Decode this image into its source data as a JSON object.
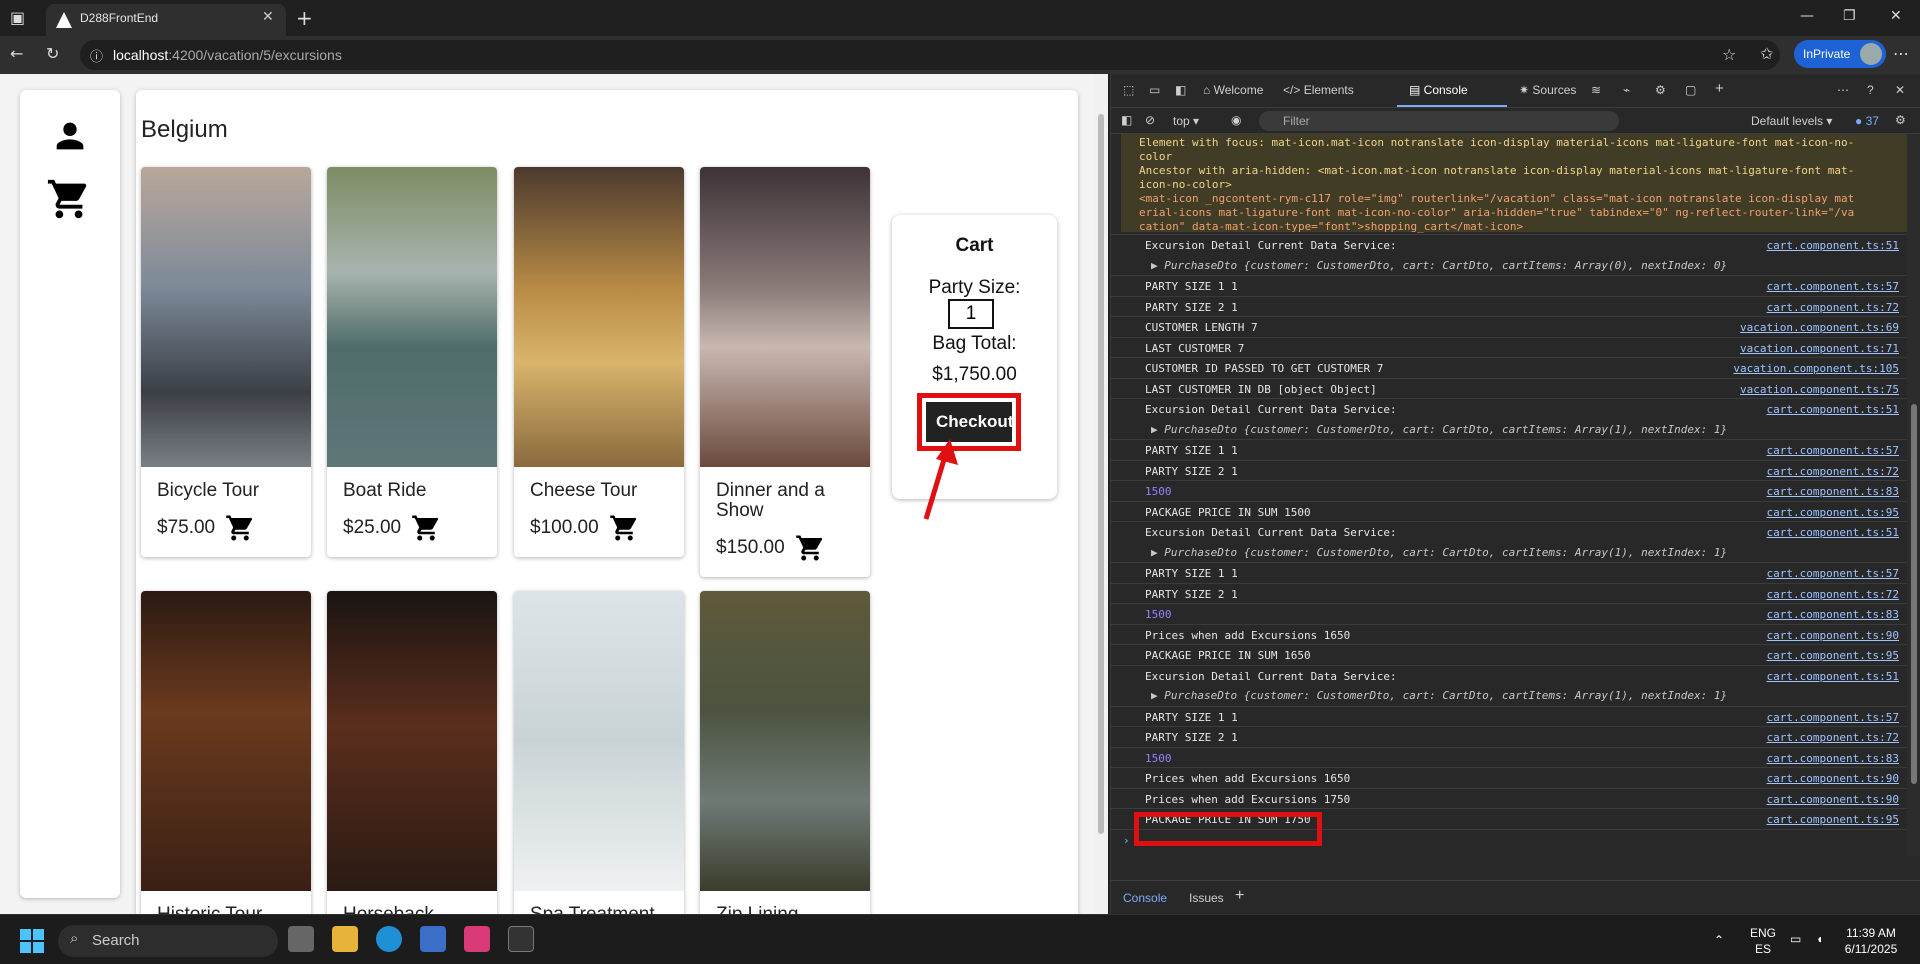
{
  "browser": {
    "tab_title": "D288FrontEnd",
    "url_host": "localhost",
    "url_rest": ":4200/vacation/5/excursions",
    "inprivate_label": "InPrivate"
  },
  "page": {
    "country": "Belgium",
    "excursions": [
      {
        "name": "Bicycle Tour",
        "price": "$75.00"
      },
      {
        "name": "Boat Ride",
        "price": "$25.00"
      },
      {
        "name": "Cheese Tour",
        "price": "$100.00"
      },
      {
        "name": "Dinner and a Show",
        "price": "$150.00"
      },
      {
        "name": "Historic Tour",
        "price": ""
      },
      {
        "name": "Horseback",
        "price": ""
      },
      {
        "name": "Spa Treatment",
        "price": ""
      },
      {
        "name": "Zip Lining",
        "price": ""
      }
    ],
    "cart": {
      "title": "Cart",
      "party_size_label": "Party Size:",
      "party_size_value": "1",
      "bag_total_label": "Bag Total:",
      "bag_total_value": "$1,750.00",
      "checkout_label": "Checkout"
    }
  },
  "devtools": {
    "tabs": [
      "Welcome",
      "Elements",
      "Console",
      "Sources"
    ],
    "context": "top",
    "filter_placeholder": "Filter",
    "levels": "Default levels",
    "issues_count": "37",
    "warning_lines": [
      "Element with focus: mat-icon.mat-icon notranslate icon-display material-icons mat-ligature-font mat-icon-no-",
      "color",
      "Ancestor with aria-hidden: <mat-icon.mat-icon notranslate icon-display material-icons mat-ligature-font mat-",
      "icon-no-color>",
      "  <mat-icon _ngcontent-rym-c117 role=\"img\" routerlink=\"/vacation\" class=\"mat-icon notranslate icon-display mat",
      "  erial-icons mat-ligature-font mat-icon-no-color\" aria-hidden=\"true\" tabindex=\"0\" ng-reflect-router-link=\"/va",
      "  cation\" data-mat-icon-type=\"font\">shopping_cart</mat-icon>"
    ],
    "logs": [
      {
        "msg": "Excursion Detail Current Data Service:",
        "src": "cart.component.ts:51",
        "style": ""
      },
      {
        "msg": "▶ PurchaseDto {customer: CustomerDto, cart: CartDto, cartItems: Array(0), nextIndex: 0}",
        "src": "",
        "style": "ital"
      },
      {
        "msg": "PARTY SIZE 1 1",
        "src": "cart.component.ts:57",
        "style": ""
      },
      {
        "msg": "PARTY SIZE 2 1",
        "src": "cart.component.ts:72",
        "style": ""
      },
      {
        "msg": "CUSTOMER LENGTH 7",
        "src": "vacation.component.ts:69",
        "style": ""
      },
      {
        "msg": "LAST CUSTOMER 7",
        "src": "vacation.component.ts:71",
        "style": ""
      },
      {
        "msg": "CUSTOMER ID PASSED TO GET CUSTOMER 7",
        "src": "vacation.component.ts:105",
        "style": ""
      },
      {
        "msg": "LAST CUSTOMER IN DB [object Object]",
        "src": "vacation.component.ts:75",
        "style": ""
      },
      {
        "msg": "Excursion Detail Current Data Service:",
        "src": "cart.component.ts:51",
        "style": ""
      },
      {
        "msg": "▶ PurchaseDto {customer: CustomerDto, cart: CartDto, cartItems: Array(1), nextIndex: 1}",
        "src": "",
        "style": "ital"
      },
      {
        "msg": "PARTY SIZE 1 1",
        "src": "cart.component.ts:57",
        "style": ""
      },
      {
        "msg": "PARTY SIZE 2 1",
        "src": "cart.component.ts:72",
        "style": ""
      },
      {
        "msg": "1500",
        "src": "cart.component.ts:83",
        "style": "num"
      },
      {
        "msg": "PACKAGE PRICE IN SUM 1500",
        "src": "cart.component.ts:95",
        "style": ""
      },
      {
        "msg": "Excursion Detail Current Data Service:",
        "src": "cart.component.ts:51",
        "style": ""
      },
      {
        "msg": "▶ PurchaseDto {customer: CustomerDto, cart: CartDto, cartItems: Array(1), nextIndex: 1}",
        "src": "",
        "style": "ital"
      },
      {
        "msg": "PARTY SIZE 1 1",
        "src": "cart.component.ts:57",
        "style": ""
      },
      {
        "msg": "PARTY SIZE 2 1",
        "src": "cart.component.ts:72",
        "style": ""
      },
      {
        "msg": "1500",
        "src": "cart.component.ts:83",
        "style": "num"
      },
      {
        "msg": "Prices when add Excursions 1650",
        "src": "cart.component.ts:90",
        "style": ""
      },
      {
        "msg": "PACKAGE PRICE IN SUM 1650",
        "src": "cart.component.ts:95",
        "style": ""
      },
      {
        "msg": "Excursion Detail Current Data Service:",
        "src": "cart.component.ts:51",
        "style": ""
      },
      {
        "msg": "▶ PurchaseDto {customer: CustomerDto, cart: CartDto, cartItems: Array(1), nextIndex: 1}",
        "src": "",
        "style": "ital"
      },
      {
        "msg": "PARTY SIZE 1 1",
        "src": "cart.component.ts:57",
        "style": ""
      },
      {
        "msg": "PARTY SIZE 2 1",
        "src": "cart.component.ts:72",
        "style": ""
      },
      {
        "msg": "1500",
        "src": "cart.component.ts:83",
        "style": "num"
      },
      {
        "msg": "Prices when add Excursions 1650",
        "src": "cart.component.ts:90",
        "style": ""
      },
      {
        "msg": "Prices when add Excursions 1750",
        "src": "cart.component.ts:90",
        "style": ""
      },
      {
        "msg": "PACKAGE PRICE IN SUM 1750",
        "src": "cart.component.ts:95",
        "style": ""
      }
    ],
    "bottom_tabs": [
      "Console",
      "Issues"
    ]
  },
  "taskbar": {
    "search_placeholder": "Search",
    "lang_top": "ENG",
    "lang_bottom": "ES",
    "time": "11:39 AM",
    "date": "6/11/2025"
  },
  "colors": {
    "highlight": "#e01010",
    "checkout_bg": "#222222",
    "devtools_bg": "#282828",
    "link": "#9ec3ff"
  }
}
